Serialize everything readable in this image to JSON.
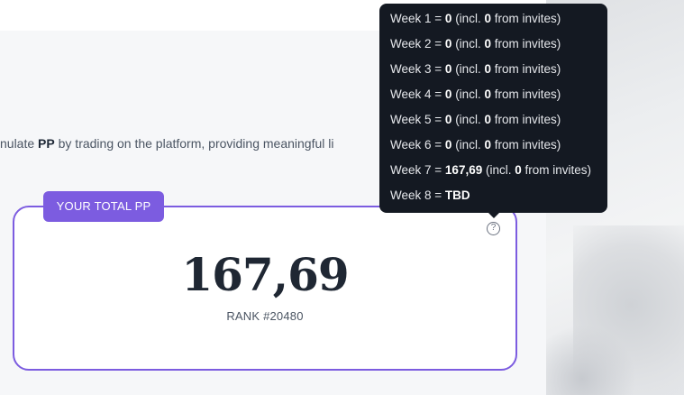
{
  "intro": {
    "prefix": "nulate ",
    "highlight": "PP",
    "suffix": " by trading on the platform, providing meaningful li"
  },
  "card": {
    "tag": "YOUR TOTAL PP",
    "value": "167,69",
    "rank": "RANK #20480",
    "help_icon": "question-circle-icon",
    "help_glyph": "?"
  },
  "tooltip": {
    "rows": [
      {
        "label": "Week 1 = ",
        "value": "0",
        "mid": " (incl. ",
        "invites": "0",
        "end": " from invites)"
      },
      {
        "label": "Week 2 = ",
        "value": "0",
        "mid": " (incl. ",
        "invites": "0",
        "end": " from invites)"
      },
      {
        "label": "Week 3 = ",
        "value": "0",
        "mid": " (incl. ",
        "invites": "0",
        "end": " from invites)"
      },
      {
        "label": "Week 4 = ",
        "value": "0",
        "mid": " (incl. ",
        "invites": "0",
        "end": " from invites)"
      },
      {
        "label": "Week 5 = ",
        "value": "0",
        "mid": " (incl. ",
        "invites": "0",
        "end": " from invites)"
      },
      {
        "label": "Week 6 = ",
        "value": "0",
        "mid": " (incl. ",
        "invites": "0",
        "end": " from invites)"
      },
      {
        "label": "Week 7 = ",
        "value": "167,69",
        "mid": " (incl. ",
        "invites": "0",
        "end": " from invites)"
      },
      {
        "label": "Week 8 = ",
        "value": "TBD",
        "mid": "",
        "invites": "",
        "end": ""
      }
    ]
  },
  "colors": {
    "accent": "#7c5ce0",
    "tooltip_bg": "#141922"
  }
}
